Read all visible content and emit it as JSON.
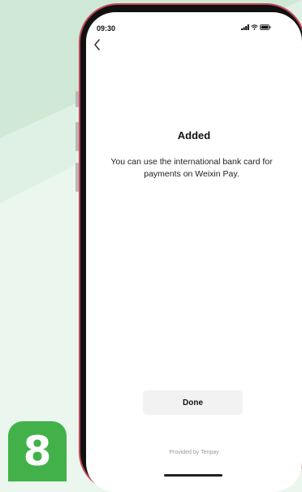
{
  "step": {
    "number": "8"
  },
  "status_bar": {
    "time": "09:30"
  },
  "result": {
    "title": "Added",
    "message": "You can use the international bank card for payments on Weixin Pay."
  },
  "actions": {
    "done_label": "Done"
  },
  "footer": {
    "provided_by": "Provided by Tenpay"
  },
  "colors": {
    "accent_green": "#43b14a",
    "frame_red": "#c34758",
    "background": "#eaf6ee"
  },
  "icons": [
    "back-chevron-icon",
    "signal-icon",
    "wifi-icon",
    "battery-icon"
  ]
}
